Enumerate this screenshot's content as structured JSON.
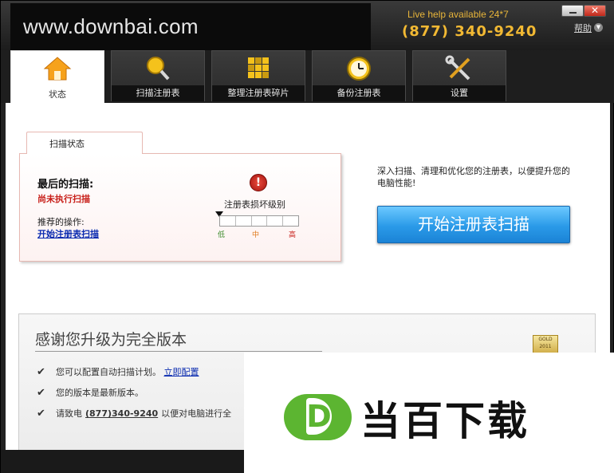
{
  "watermark": "www.downbai.com",
  "header": {
    "live_help": "Live help available 24*7",
    "phone": "(877) 340-9240",
    "help": "帮助"
  },
  "tabs": [
    {
      "label": "状态",
      "icon": "home-icon"
    },
    {
      "label": "扫描注册表",
      "icon": "magnifier-icon"
    },
    {
      "label": "整理注册表碎片",
      "icon": "defrag-icon"
    },
    {
      "label": "备份注册表",
      "icon": "clock-icon"
    },
    {
      "label": "设置",
      "icon": "tools-icon"
    }
  ],
  "status": {
    "tab_label": "扫描状态",
    "last_scan_label": "最后的扫描:",
    "last_scan_value": "尚未执行扫描",
    "recommended_label": "推荐的操作:",
    "recommended_link": "开始注册表扫描",
    "damage_label": "注册表损坏级别",
    "damage_level": 0,
    "meter_low": "低",
    "meter_mid": "中",
    "meter_high": "高"
  },
  "intro_text": "深入扫描、清理和优化您的注册表，以便提升您的电脑性能!",
  "scan_button": "开始注册表扫描",
  "upgrade": {
    "title": "感谢您升级为完全版本",
    "feature_1": "您可以配置自动扫描计划。",
    "feature_1_link": "立即配置",
    "feature_2": "您的版本是最新版本。",
    "feature_3_pre": "请致电",
    "feature_3_phone": "(877)340-9240",
    "feature_3_post": "以便对电脑进行全",
    "badge_top": "GOLD",
    "badge_year": "2011"
  },
  "overlay_logo": "当百下载",
  "colors": {
    "accent": "#f2b933",
    "button_blue": "#2a9ae8",
    "warning_red": "#c8201a",
    "logo_green": "#5cb531"
  }
}
